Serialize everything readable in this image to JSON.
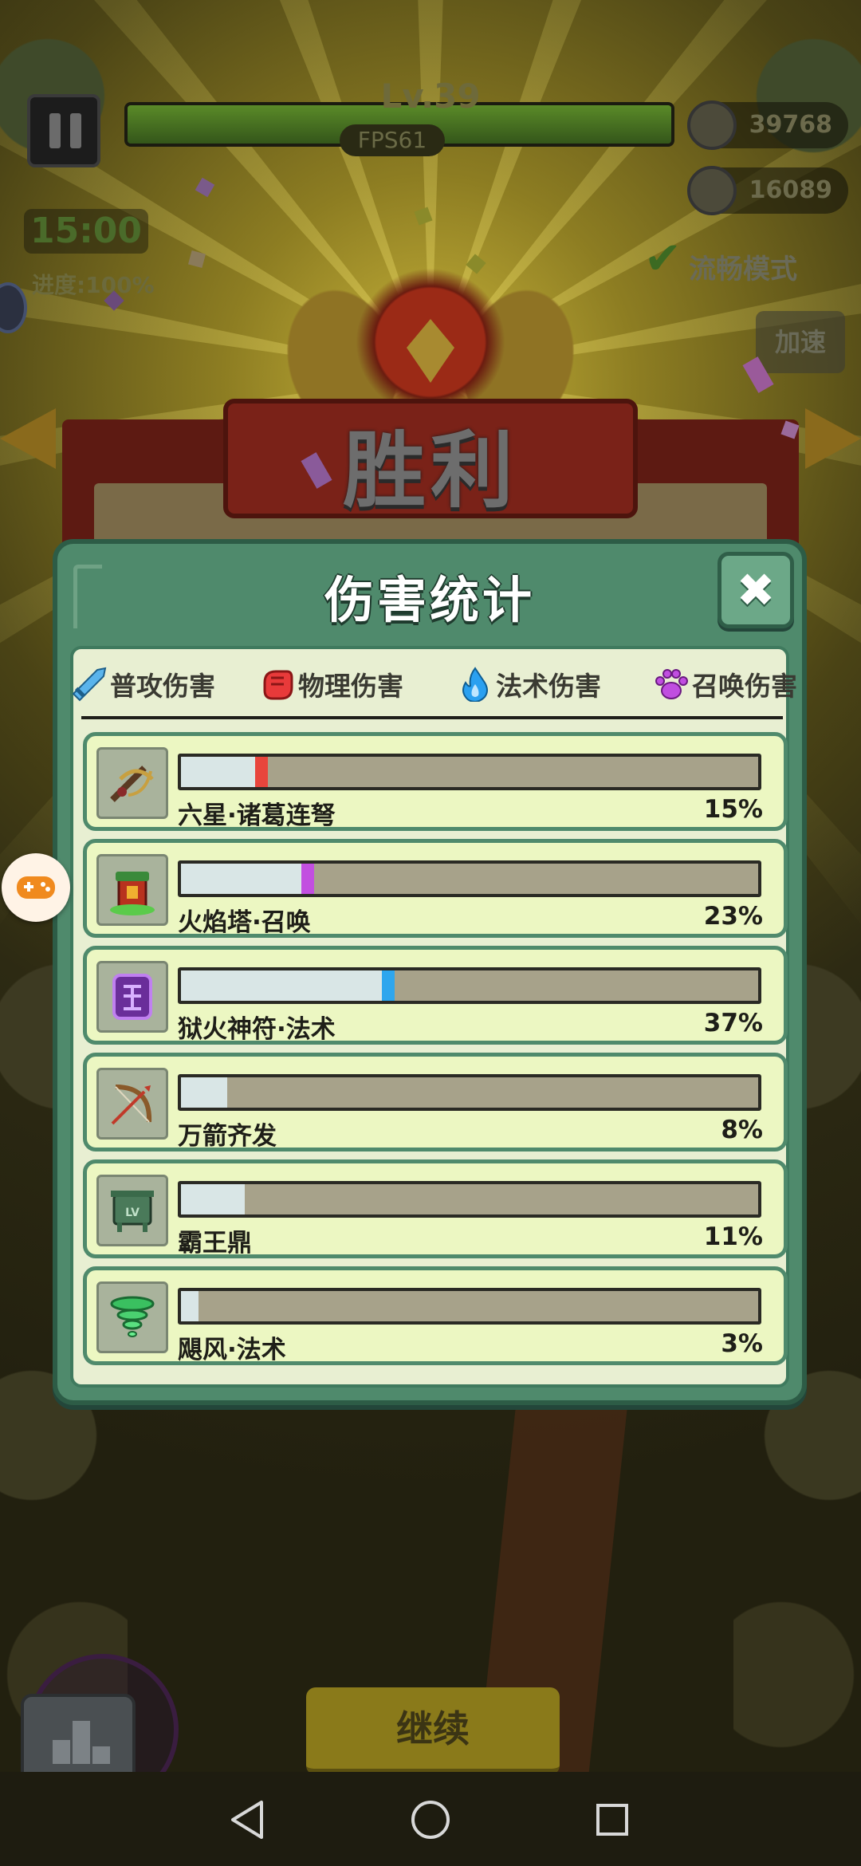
{
  "hud": {
    "level": "Lv.39",
    "fps": "FPS61",
    "coins": "39768",
    "kills": "16089",
    "timer": "15:00",
    "progress": "进度:100%",
    "smooth_mode": "流畅模式",
    "speed_up": "加速",
    "xp_fill": 1.0
  },
  "victory": {
    "title": "胜利"
  },
  "dialog": {
    "title": "伤害统计",
    "close_symbol": "✖",
    "legend": [
      {
        "label": "普攻伤害",
        "icon": "sword-icon",
        "color": "#4aa8e8"
      },
      {
        "label": "物理伤害",
        "icon": "fist-icon",
        "color": "#e83a3a"
      },
      {
        "label": "法术伤害",
        "icon": "flame-icon",
        "color": "#2aa0f0"
      },
      {
        "label": "召唤伤害",
        "icon": "paw-icon",
        "color": "#c04ee0"
      }
    ],
    "rows": [
      {
        "name": "六星·诸葛连弩",
        "pct": "15%",
        "fraction": 0.15,
        "tip_color": "#e8453c",
        "icon": "crossbow-icon"
      },
      {
        "name": "火焰塔·召唤",
        "pct": "23%",
        "fraction": 0.23,
        "tip_color": "#c24fe0",
        "icon": "fire-tower-icon"
      },
      {
        "name": "狱火神符·法术",
        "pct": "37%",
        "fraction": 0.37,
        "tip_color": "#2ea6ee",
        "icon": "rune-icon"
      },
      {
        "name": "万箭齐发",
        "pct": "8%",
        "fraction": 0.08,
        "tip_color": "",
        "icon": "bow-icon"
      },
      {
        "name": "霸王鼎",
        "pct": "11%",
        "fraction": 0.11,
        "tip_color": "",
        "icon": "cauldron-icon"
      },
      {
        "name": "飓风·法术",
        "pct": "3%",
        "fraction": 0.03,
        "tip_color": "",
        "icon": "tornado-icon"
      }
    ]
  },
  "bottom": {
    "continue_label": "继续"
  }
}
